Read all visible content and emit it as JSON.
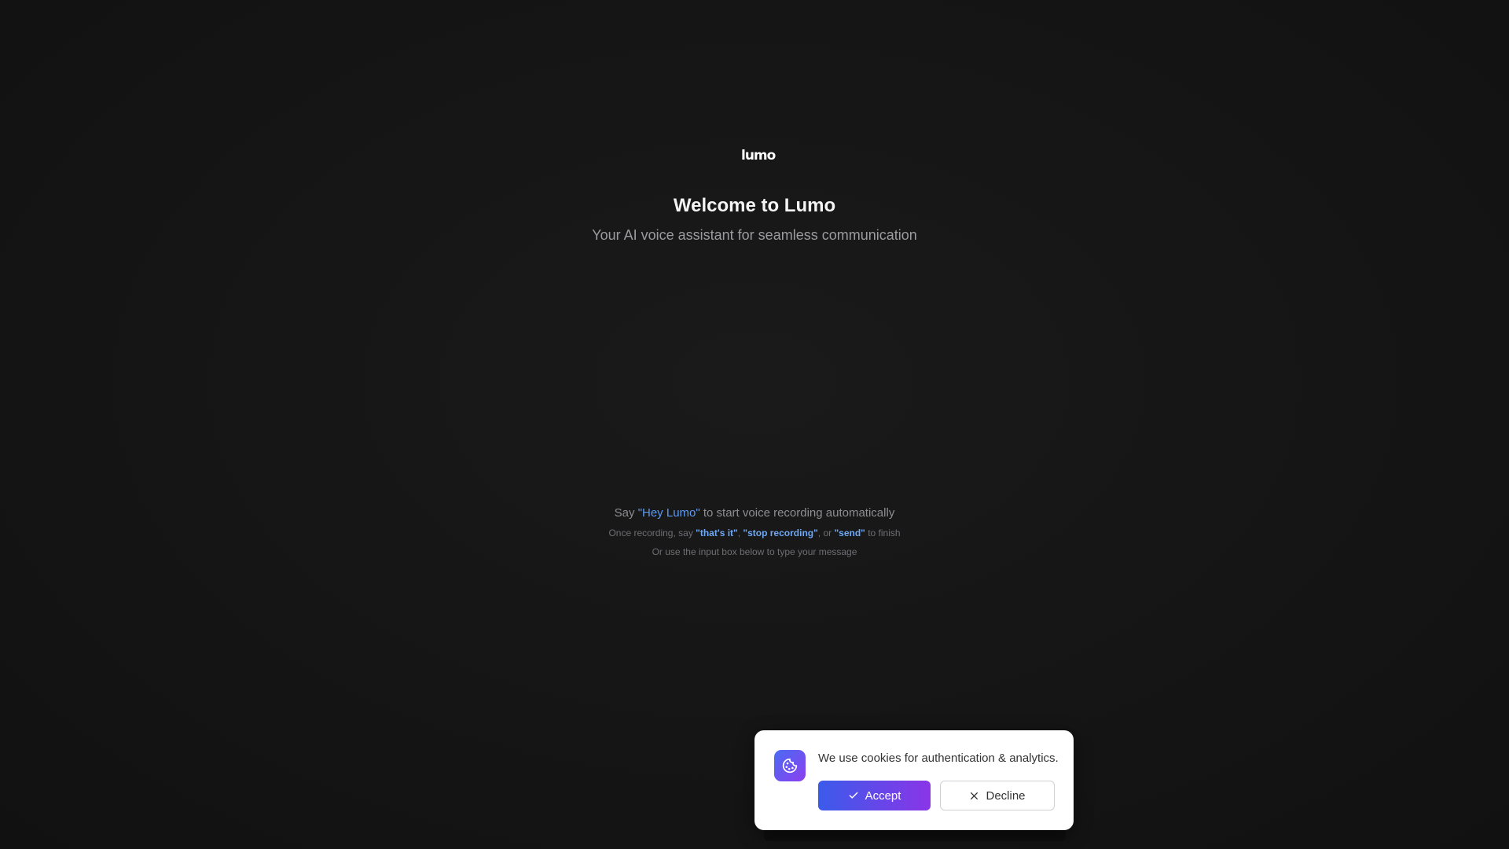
{
  "brand": {
    "logo_text": "lumo"
  },
  "hero": {
    "title": "Welcome to Lumo",
    "subtitle": "Your AI voice assistant for seamless communication"
  },
  "hints": {
    "line1": {
      "prefix": "Say ",
      "wake_word": "\"Hey Lumo\"",
      "suffix": " to start voice recording automatically"
    },
    "line2": {
      "prefix": "Once recording, say ",
      "cmd1": "\"that's it\"",
      "sep1": ", ",
      "cmd2": "\"stop recording\"",
      "sep2": ", or ",
      "cmd3": "\"send\"",
      "suffix": " to finish"
    },
    "line3": "Or use the input box below to type your message"
  },
  "cookie_banner": {
    "icon": "cookie-icon",
    "message": "We use cookies for authentication & analytics.",
    "accept_label": "Accept",
    "accept_icon": "check-icon",
    "decline_label": "Decline",
    "decline_icon": "close-icon"
  },
  "colors": {
    "background": "#141414",
    "highlight": "#5b9bf5",
    "accent_start": "#3b5bea",
    "accent_end": "#8a35e8"
  }
}
